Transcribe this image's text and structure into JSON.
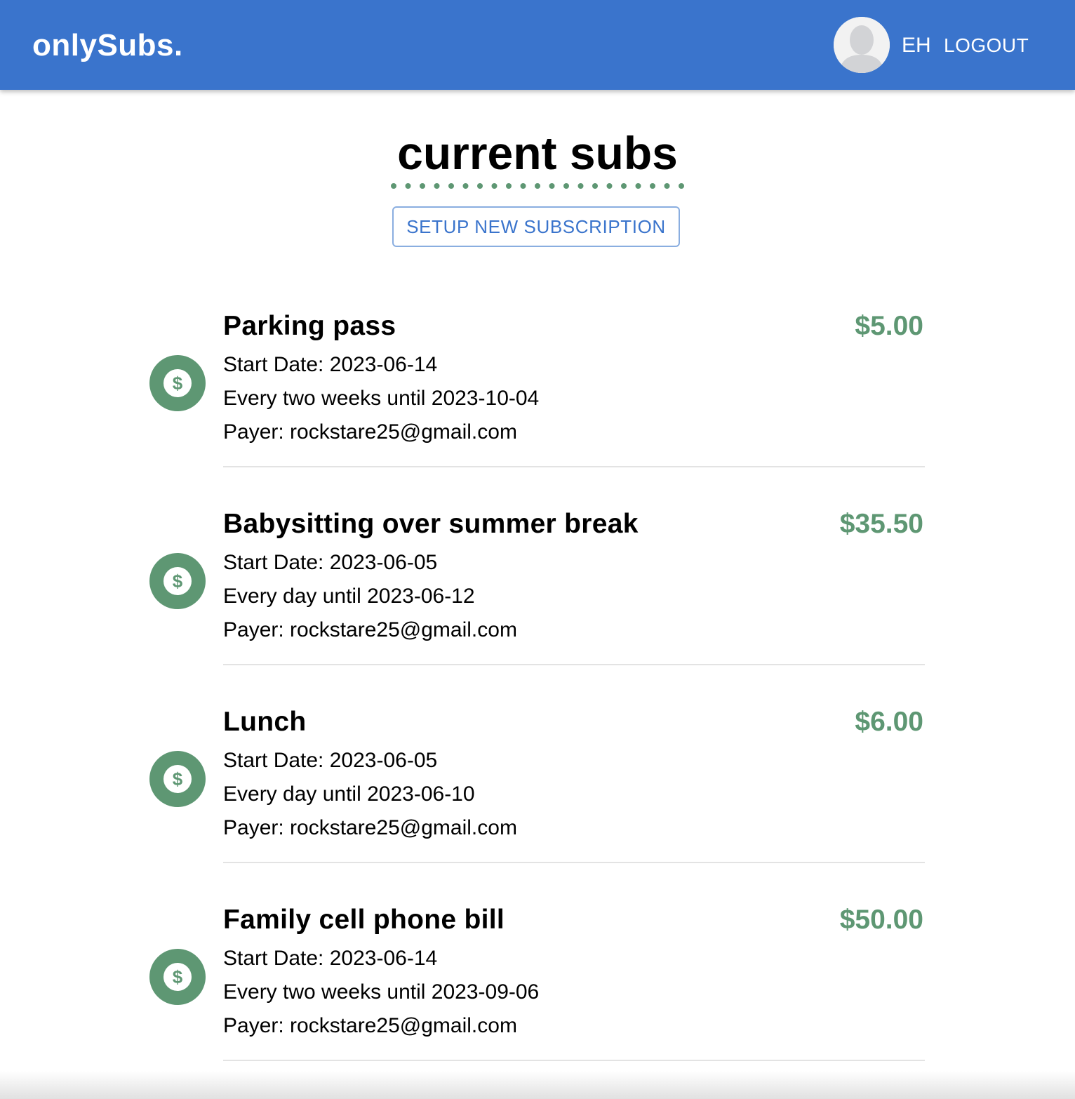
{
  "header": {
    "logo": "onlySubs.",
    "user_initials": "EH",
    "logout_label": "LOGOUT",
    "bar_color": "#3a74cc",
    "avatar_icon": "user-avatar-icon"
  },
  "page": {
    "title": "current subs",
    "setup_button_label": "SETUP NEW SUBSCRIPTION",
    "accent_color": "#5e9773"
  },
  "subscriptions": [
    {
      "name": "Parking pass",
      "amount": "$5.00",
      "start": "Start Date: 2023-06-14",
      "frequency": "Every two weeks until 2023-10-04",
      "payer": "Payer: rockstare25@gmail.com",
      "icon": "dollar-icon"
    },
    {
      "name": "Babysitting over summer break",
      "amount": "$35.50",
      "start": "Start Date: 2023-06-05",
      "frequency": "Every day until 2023-06-12",
      "payer": "Payer: rockstare25@gmail.com",
      "icon": "dollar-icon"
    },
    {
      "name": "Lunch",
      "amount": "$6.00",
      "start": "Start Date: 2023-06-05",
      "frequency": "Every day until 2023-06-10",
      "payer": "Payer: rockstare25@gmail.com",
      "icon": "dollar-icon"
    },
    {
      "name": "Family cell phone bill",
      "amount": "$50.00",
      "start": "Start Date: 2023-06-14",
      "frequency": "Every two weeks until 2023-09-06",
      "payer": "Payer: rockstare25@gmail.com",
      "icon": "dollar-icon"
    }
  ]
}
